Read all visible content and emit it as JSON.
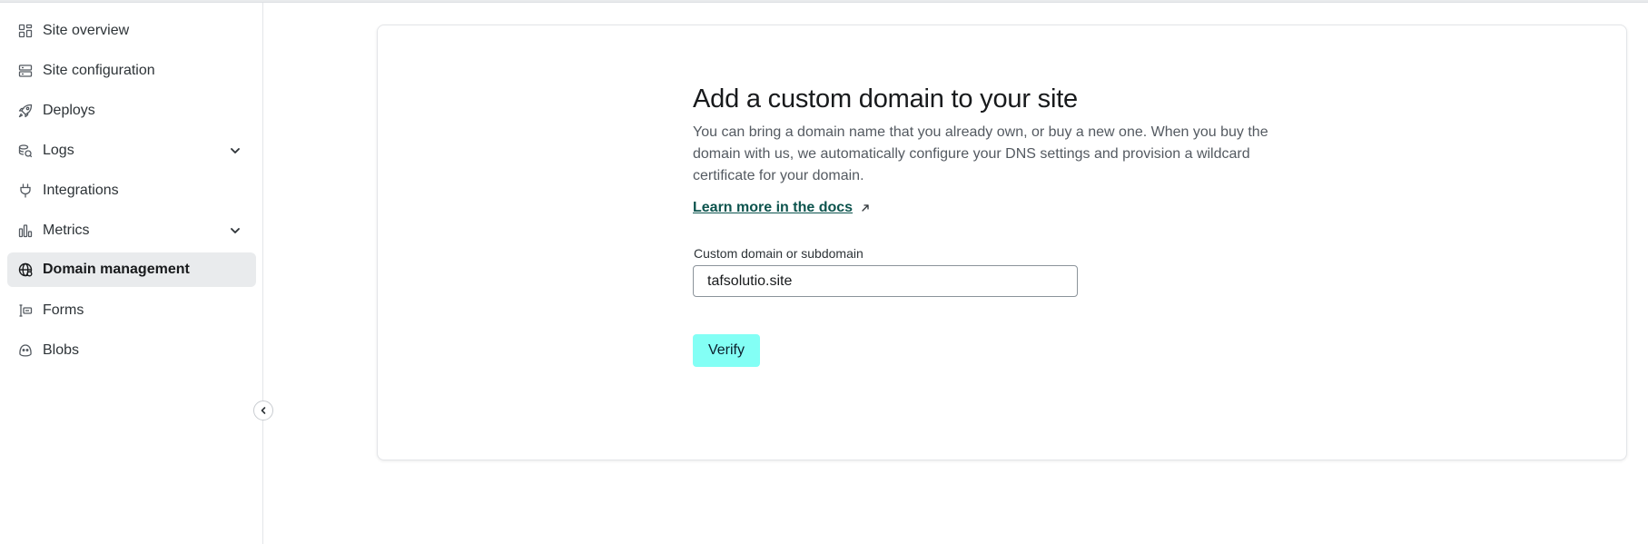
{
  "sidebar": {
    "items": [
      {
        "label": "Site overview",
        "icon": "grid-icon",
        "expandable": false,
        "active": false
      },
      {
        "label": "Site configuration",
        "icon": "server-icon",
        "expandable": false,
        "active": false
      },
      {
        "label": "Deploys",
        "icon": "rocket-icon",
        "expandable": false,
        "active": false
      },
      {
        "label": "Logs",
        "icon": "logs-icon",
        "expandable": true,
        "active": false
      },
      {
        "label": "Integrations",
        "icon": "plug-icon",
        "expandable": false,
        "active": false
      },
      {
        "label": "Metrics",
        "icon": "bar-chart-icon",
        "expandable": true,
        "active": false
      },
      {
        "label": "Domain management",
        "icon": "globe-icon",
        "expandable": false,
        "active": true
      },
      {
        "label": "Forms",
        "icon": "form-icon",
        "expandable": false,
        "active": false
      },
      {
        "label": "Blobs",
        "icon": "blob-icon",
        "expandable": false,
        "active": false
      }
    ],
    "collapse_icon": "chevron-left-icon"
  },
  "main": {
    "title": "Add a custom domain to your site",
    "description": "You can bring a domain name that you already own, or buy a new one. When you buy the domain with us, we automatically configure your DNS settings and provision a wildcard certificate for your domain.",
    "docs_link": "Learn more in the docs",
    "docs_link_icon": "external-link-icon",
    "field_label": "Custom domain or subdomain",
    "field_value": "tafsolutio.site",
    "verify_label": "Verify"
  },
  "colors": {
    "accent_button": "#83fff5",
    "link": "#0d544e",
    "active_nav_bg": "#e9ebed"
  }
}
